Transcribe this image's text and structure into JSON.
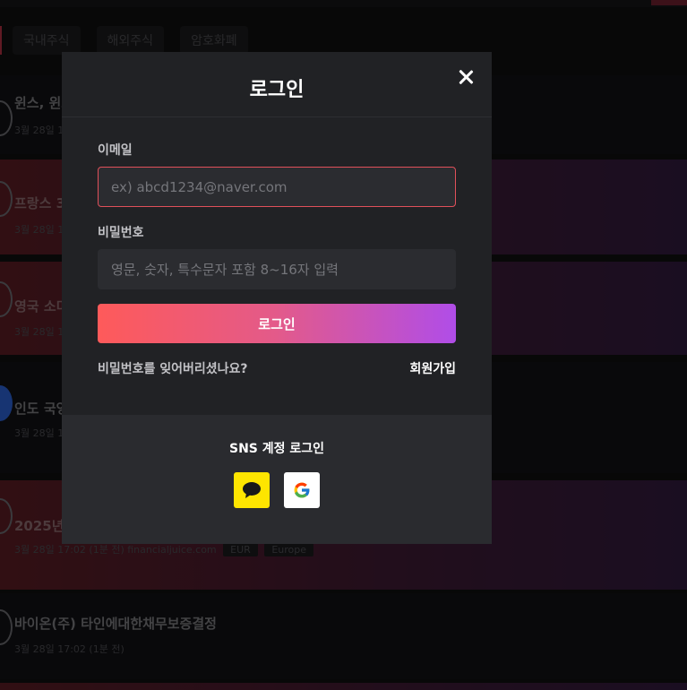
{
  "background": {
    "tabs": [
      "국내주식",
      "해외주식",
      "암호화폐"
    ],
    "news": [
      {
        "title": "윈스, 윈스",
        "meta": "3월 28일 1"
      },
      {
        "title": "프랑스 3",
        "meta": "3월 28일 1"
      },
      {
        "title": "영국 소미",
        "meta": "3월 28일 1"
      },
      {
        "title": "인도 국영",
        "meta": "3월 28일 1"
      },
      {
        "title": "2025년",
        "meta": "3월 28일 17:02 (1분 전)  financialjuice.com",
        "tags": [
          "EUR",
          "Europe"
        ]
      },
      {
        "title": "바이온(주) 타인에대한채무보증결정",
        "meta": "3월 28일 17:02 (1분 전)"
      }
    ]
  },
  "modal": {
    "title": "로그인",
    "email_label": "이메일",
    "email_placeholder": "ex) abcd1234@naver.com",
    "password_label": "비밀번호",
    "password_placeholder": "영문, 숫자, 특수문자 포함 8~16자 입력",
    "login_button": "로그인",
    "forgot_password": "비밀번호를 잊어버리셨나요?",
    "signup": "회원가입",
    "sns_title": "SNS 계정 로그인",
    "sns_buttons": [
      {
        "name": "kakao",
        "icon": "kakao-speech-bubble-icon",
        "color": "#fee500"
      },
      {
        "name": "google",
        "icon": "google-g-icon",
        "color": "#ffffff"
      }
    ]
  },
  "colors": {
    "accent_start": "#fe5a5a",
    "accent_end": "#b04de8",
    "input_focus_border": "#e0505a"
  }
}
